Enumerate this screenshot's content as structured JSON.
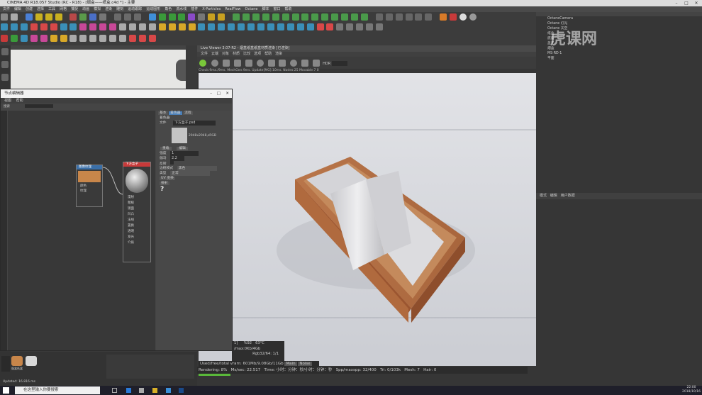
{
  "window": {
    "title": "CINEMA 4D R18.057 Studio (RC - R18) - [烟盒——纸盒.c4d *] - 主要"
  },
  "menubar": {
    "items": [
      "文件",
      "编辑",
      "创建",
      "选择",
      "工具",
      "网格",
      "捕捉",
      "动画",
      "模拟",
      "渲染",
      "雕刻",
      "运动跟踪",
      "运动图形",
      "角色",
      "流水线",
      "插件",
      "X-Particles",
      "RealFlow",
      "Octane",
      "脚本",
      "窗口",
      "帮助"
    ]
  },
  "live_viewer": {
    "title": "Live Viewer 3.07-R2 - 烟盒纸盒纸盒材质渲染 [已渲染]",
    "menu": [
      "文件",
      "云端",
      "对象",
      "材质",
      "比较",
      "选项",
      "帮助",
      "渲染"
    ],
    "info": "Check:9ms./9ms. MeshGen:9ms. Update[MG]:10ms. Nodes:25 Movable:7 0",
    "channel": "HDR"
  },
  "material_editor": {
    "title": "节点编辑器",
    "menu": [
      "视图",
      "帮助"
    ],
    "sub_label": "搜索",
    "node1_title": "图像纹理",
    "node2_title": "下方盒子",
    "node2_inputs": [
      "漫射",
      "粗糙",
      "镜面",
      "凹凸",
      "法线",
      "置换",
      "透明",
      "发光",
      "介质"
    ],
    "node1_outputs": [
      "颜色",
      "纹理"
    ],
    "tabs": [
      "基本",
      "着色器",
      "流程"
    ],
    "section_label": "着色器",
    "file_label": "文件",
    "file_value": "下方盒子.psd",
    "image_info": "2048x2048,sRGB",
    "btn_reload": "重载",
    "btn_edit": "编辑",
    "rows": [
      {
        "label": "强度",
        "value": "1"
      },
      {
        "label": "伽马",
        "value": "2.2"
      },
      {
        "label": "反转",
        "value": ""
      },
      {
        "label": "边框模式",
        "value": "黑色"
      },
      {
        "label": "类型",
        "value": "正常"
      }
    ],
    "uv_label": "UV 变换",
    "proj_label": "投射",
    "help": "?"
  },
  "stats": {
    "line1_a": "1]",
    "line1_b": "%92",
    "line1_c": "63°C",
    "line2": "/max:0Kb/4Gb",
    "line3": "Rgb32/64: 1/1"
  },
  "vram": {
    "text": "Used/free/total vram: 601Mb/9.08Gb/11Gb",
    "main": "Main",
    "noise": "Noise"
  },
  "statusbar": {
    "rendering": "Rendering: 8%",
    "ms": "Ms/sec: 22.517",
    "time": "Time: 小时：分钟：秒/小时：分钟：秒",
    "spp": "Spp/maxspp: 32/400",
    "tri": "Tri: 0/103k",
    "mesh": "Mesh: 7",
    "hair": "Hair: 0"
  },
  "object_manager": {
    "objects": [
      {
        "name": "OctaneCamera"
      },
      {
        "name": "Octane 灯光"
      },
      {
        "name": "Octane 天空"
      },
      {
        "name": "纸盒"
      },
      {
        "name": "底座"
      },
      {
        "name": "盖子"
      },
      {
        "name": "烟盒"
      },
      {
        "name": "MS·RD·1"
      },
      {
        "name": "平面"
      }
    ]
  },
  "attributes": {
    "tabs": [
      "模式",
      "编辑",
      "用户数据"
    ]
  },
  "bottom": {
    "status": "Updated: 16.816 ms",
    "slot_label": "烟盒纸盒"
  },
  "taskbar": {
    "search": "在这里输入你要搜索",
    "time": "22:00",
    "date": "2018/10/16"
  },
  "watermark": "虎课网"
}
